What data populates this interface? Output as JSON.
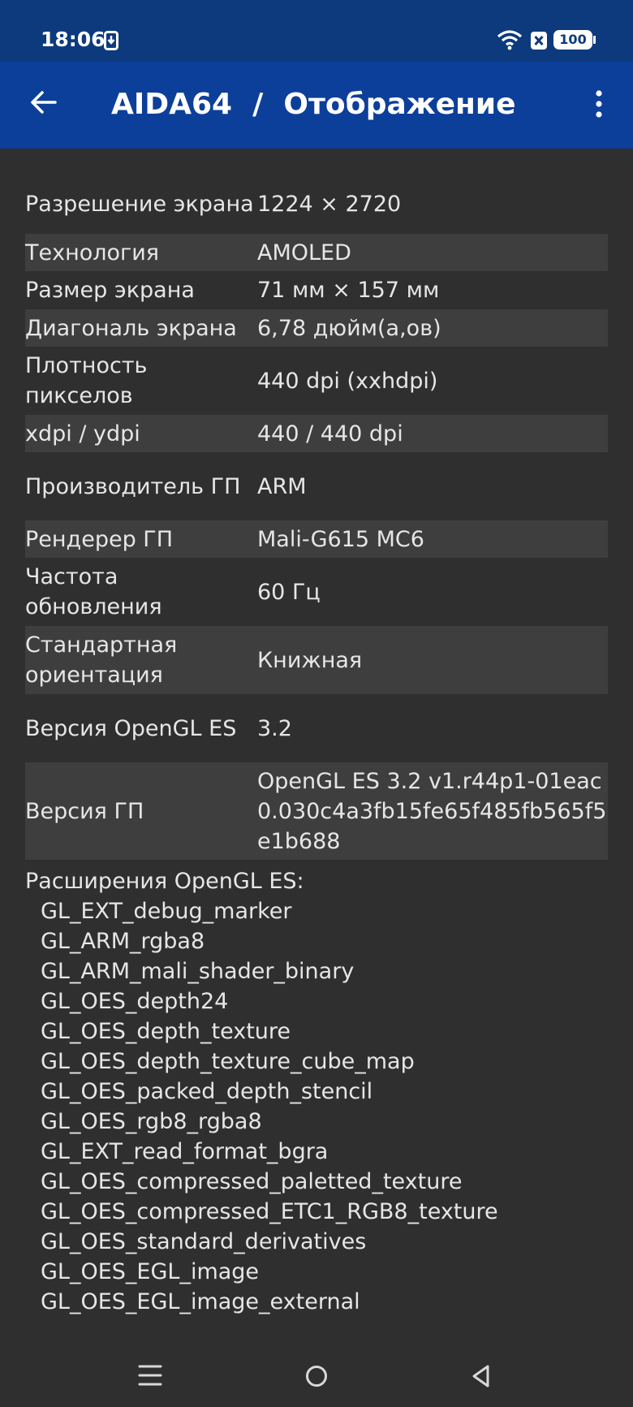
{
  "status": {
    "time": "18:06",
    "battery": "100"
  },
  "appbar": {
    "title": "AIDA64  /  Отображение"
  },
  "rows": [
    {
      "label": "Разрешение экрана",
      "value": "1224 × 2720"
    },
    {
      "label": "Технология",
      "value": "AMOLED"
    },
    {
      "label": "Размер экрана",
      "value": "71 мм × 157 мм"
    },
    {
      "label": "Диагональ экрана",
      "value": "6,78 дюйм(а,ов)"
    },
    {
      "label": "Плотность пикселов",
      "value": "440 dpi (xxhdpi)"
    },
    {
      "label": "xdpi / ydpi",
      "value": "440 / 440 dpi"
    },
    {
      "label": "Производитель ГП",
      "value": "ARM"
    },
    {
      "label": "Рендерер ГП",
      "value": "Mali-G615 MC6"
    },
    {
      "label": "Частота обновления",
      "value": "60 Гц"
    },
    {
      "label": "Стандартная ориентация",
      "value": "Книжная"
    },
    {
      "label": "Версия OpenGL ES",
      "value": "3.2"
    },
    {
      "label": "Версия ГП",
      "value": "OpenGL ES 3.2 v1.r44p1-01eac0.030c4a3fb15fe65f485fb565f5e1b688"
    }
  ],
  "extensions": {
    "heading": "Расширения OpenGL ES:",
    "items": [
      "GL_EXT_debug_marker",
      "GL_ARM_rgba8",
      "GL_ARM_mali_shader_binary",
      "GL_OES_depth24",
      "GL_OES_depth_texture",
      "GL_OES_depth_texture_cube_map",
      "GL_OES_packed_depth_stencil",
      "GL_OES_rgb8_rgba8",
      "GL_EXT_read_format_bgra",
      "GL_OES_compressed_paletted_texture",
      "GL_OES_compressed_ETC1_RGB8_texture",
      "GL_OES_standard_derivatives",
      "GL_OES_EGL_image",
      "GL_OES_EGL_image_external"
    ]
  }
}
